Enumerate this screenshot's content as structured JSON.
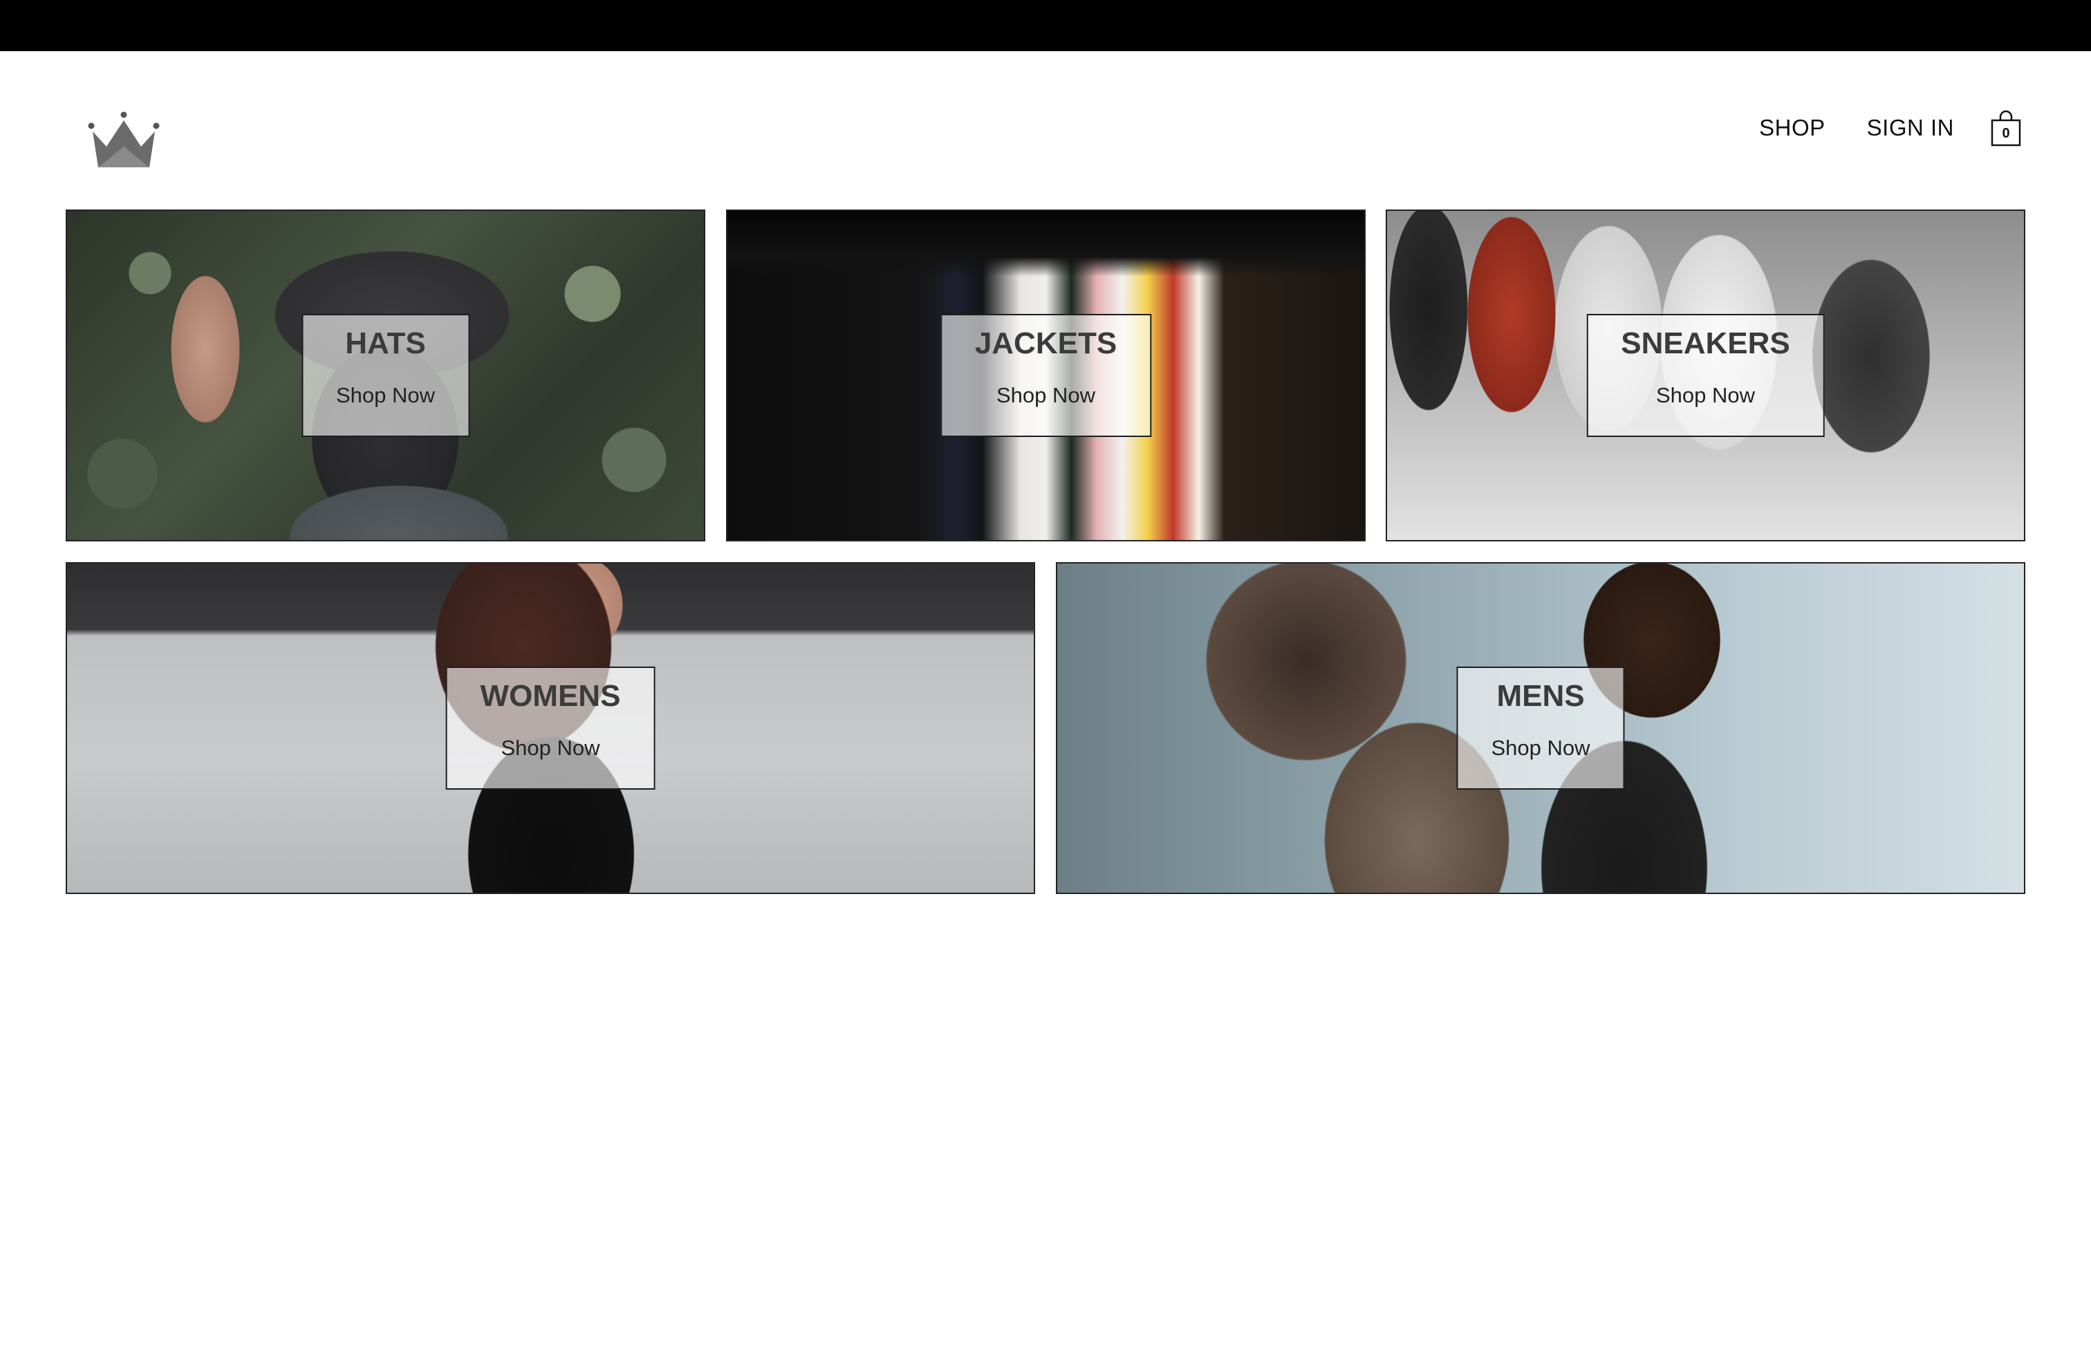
{
  "header": {
    "logo_icon": "crown-icon",
    "nav": {
      "shop_label": "SHOP",
      "sign_in_label": "SIGN IN"
    },
    "cart": {
      "icon": "shopping-bag-icon",
      "count": "0"
    }
  },
  "categories": [
    {
      "title": "HATS",
      "cta": "Shop Now"
    },
    {
      "title": "JACKETS",
      "cta": "Shop Now"
    },
    {
      "title": "SNEAKERS",
      "cta": "Shop Now"
    },
    {
      "title": "WOMENS",
      "cta": "Shop Now"
    },
    {
      "title": "MENS",
      "cta": "Shop Now"
    }
  ],
  "colors": {
    "top_bar": "#000000",
    "background": "#ffffff",
    "logo": "#6b6b6b",
    "label_overlay": "rgba(255,255,255,0.62)"
  }
}
